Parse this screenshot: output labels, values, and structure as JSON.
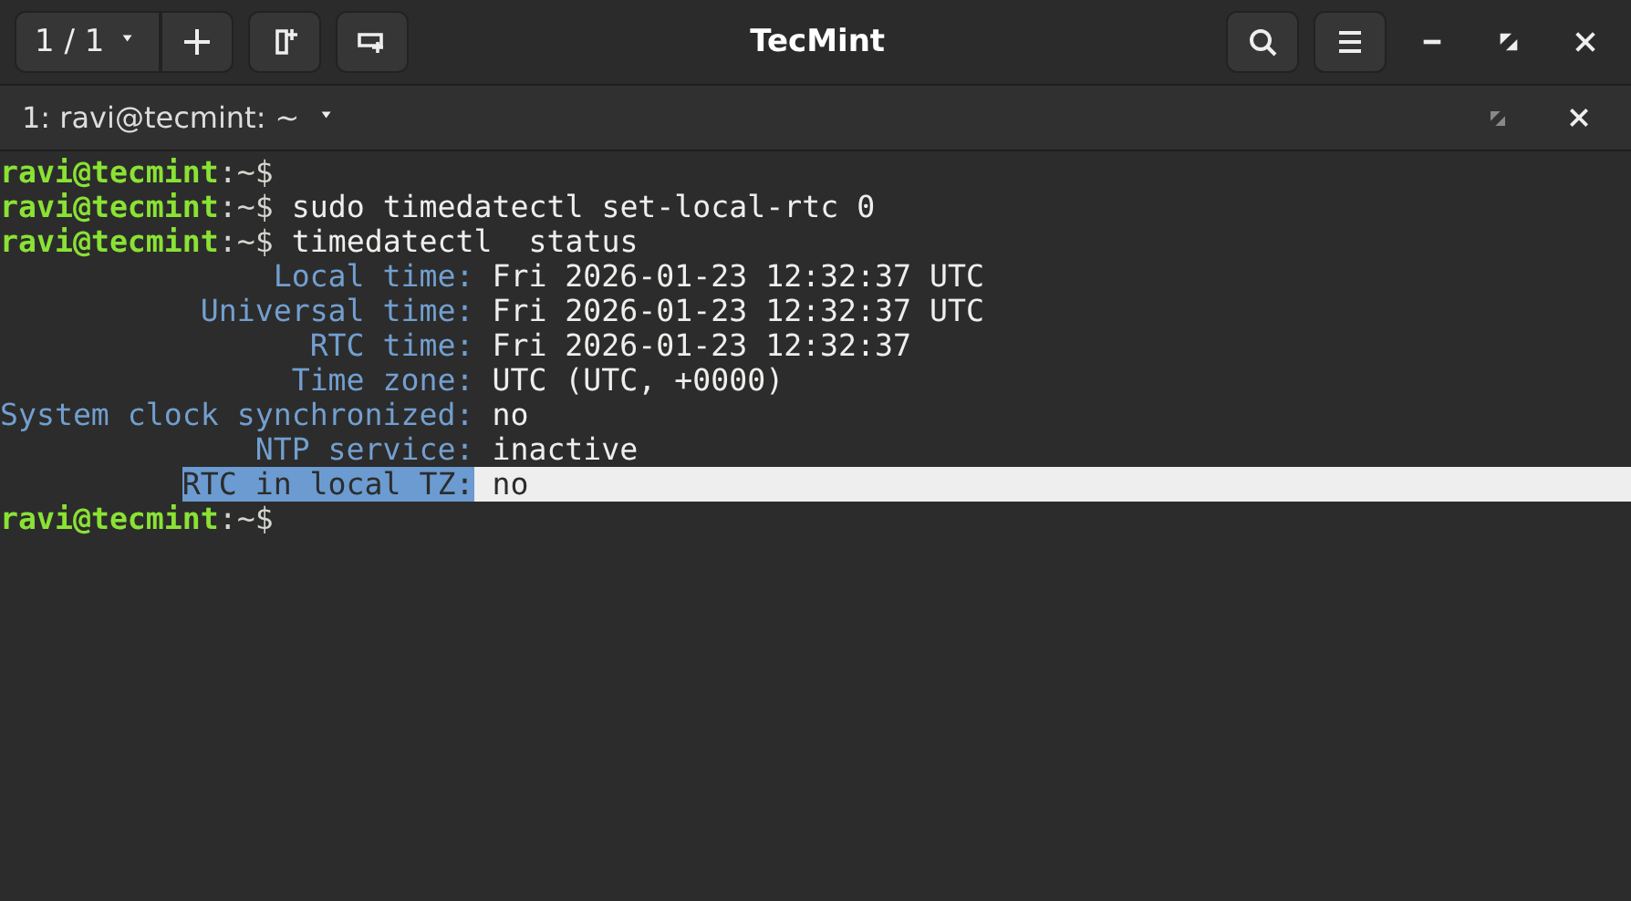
{
  "window": {
    "title": "TecMint",
    "tab_counter": "1 / 1"
  },
  "tabs": [
    {
      "label": "1: ravi@tecmint: ~",
      "selected": true
    }
  ],
  "terminal": {
    "lines": [
      {
        "kind": "prompt",
        "user": "ravi@tecmint",
        "path": ":~$"
      },
      {
        "kind": "prompt",
        "user": "ravi@tecmint",
        "path": ":~$",
        "command": "sudo timedatectl set-local-rtc 0"
      },
      {
        "kind": "prompt",
        "user": "ravi@tecmint",
        "path": ":~$",
        "command": "timedatectl  status"
      },
      {
        "kind": "field",
        "label": "Local time:",
        "value": "Fri 2026-01-23 12:32:37 UTC",
        "highlighted": false
      },
      {
        "kind": "field",
        "label": "Universal time:",
        "value": "Fri 2026-01-23 12:32:37 UTC",
        "highlighted": false
      },
      {
        "kind": "field",
        "label": "RTC time:",
        "value": "Fri 2026-01-23 12:32:37",
        "highlighted": false
      },
      {
        "kind": "field",
        "label": "Time zone:",
        "value": "UTC (UTC, +0000)",
        "highlighted": false
      },
      {
        "kind": "field",
        "label": "System clock synchronized:",
        "value": "no",
        "highlighted": false
      },
      {
        "kind": "field",
        "label": "NTP service:",
        "value": "inactive",
        "highlighted": false
      },
      {
        "kind": "field",
        "label": "RTC in local TZ:",
        "value": "no",
        "highlighted": true
      },
      {
        "kind": "prompt",
        "user": "ravi@tecmint",
        "path": ":~$"
      }
    ]
  }
}
